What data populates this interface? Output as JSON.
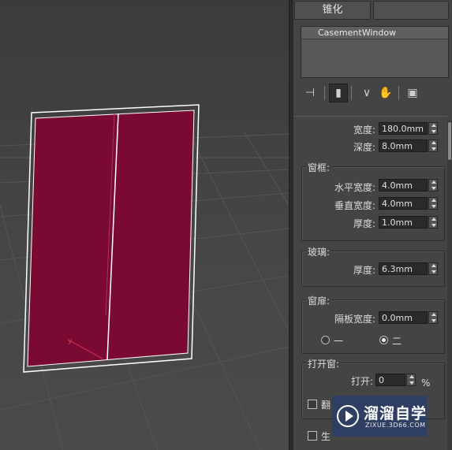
{
  "toolbar_tabs": {
    "left": "锥化",
    "right": ""
  },
  "object_name": "CasementWindow",
  "icons": [
    "pin-icon",
    "modifier-stack-icon",
    "show-end-result-icon",
    "make-unique-icon",
    "remove-modifier-icon",
    "configure-modifier-sets-icon"
  ],
  "params": {
    "width_label": "宽度:",
    "width_value": "180.0mm",
    "depth_label": "深度:",
    "depth_value": "8.0mm"
  },
  "frame": {
    "title": "窗框:",
    "h_width_label": "水平宽度:",
    "h_width_value": "4.0mm",
    "v_width_label": "垂直宽度:",
    "v_width_value": "4.0mm",
    "thickness_label": "厚度:",
    "thickness_value": "1.0mm"
  },
  "glass": {
    "title": "玻璃:",
    "thickness_label": "厚度:",
    "thickness_value": "6.3mm"
  },
  "sash": {
    "title": "窗扉:",
    "panel_width_label": "隔板宽度:",
    "panel_width_value": "0.0mm",
    "option_one": "一",
    "option_two": "二",
    "selected": "二"
  },
  "open_window": {
    "title": "打开窗:",
    "open_label": "打开:",
    "open_value": "0",
    "unit": "%",
    "flip_label": "翻",
    "generate_label": "生"
  },
  "watermark": {
    "title": "溜溜自学",
    "url": "ZIXUE.3D66.COM"
  },
  "colors": {
    "window_fill": "#7a0a34",
    "wire": "#ffffff",
    "panel_bg": "#444444"
  }
}
